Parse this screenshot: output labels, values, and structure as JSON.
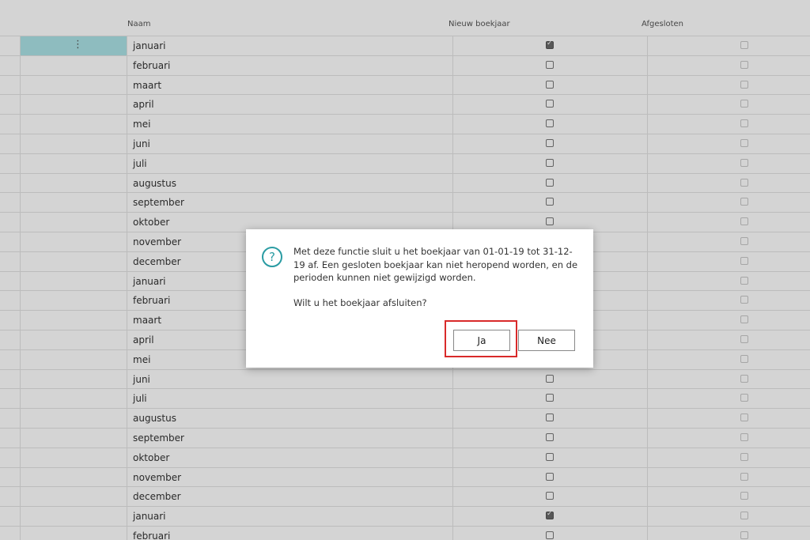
{
  "columns": {
    "naam": "Naam",
    "nieuw_boekjaar": "Nieuw boekjaar",
    "afgesloten": "Afgesloten"
  },
  "rows": [
    {
      "name": "januari",
      "new_year": true
    },
    {
      "name": "februari",
      "new_year": false
    },
    {
      "name": "maart",
      "new_year": false
    },
    {
      "name": "april",
      "new_year": false
    },
    {
      "name": "mei",
      "new_year": false
    },
    {
      "name": "juni",
      "new_year": false
    },
    {
      "name": "juli",
      "new_year": false
    },
    {
      "name": "augustus",
      "new_year": false
    },
    {
      "name": "september",
      "new_year": false
    },
    {
      "name": "oktober",
      "new_year": false
    },
    {
      "name": "november",
      "new_year": false
    },
    {
      "name": "december",
      "new_year": false
    },
    {
      "name": "januari",
      "new_year": true
    },
    {
      "name": "februari",
      "new_year": false
    },
    {
      "name": "maart",
      "new_year": false
    },
    {
      "name": "april",
      "new_year": false
    },
    {
      "name": "mei",
      "new_year": false
    },
    {
      "name": "juni",
      "new_year": false
    },
    {
      "name": "juli",
      "new_year": false
    },
    {
      "name": "augustus",
      "new_year": false
    },
    {
      "name": "september",
      "new_year": false
    },
    {
      "name": "oktober",
      "new_year": false
    },
    {
      "name": "november",
      "new_year": false
    },
    {
      "name": "december",
      "new_year": false
    },
    {
      "name": "januari",
      "new_year": true
    },
    {
      "name": "februari",
      "new_year": false
    }
  ],
  "dialog": {
    "icon": "question-icon",
    "message": "Met deze functie sluit u het boekjaar van 01-01-19 tot 31-12-19 af. Een gesloten boekjaar kan niet heropend worden, en de perioden kunnen niet gewijzigd worden.",
    "question": "Wilt u het boekjaar afsluiten?",
    "yes_label": "Ja",
    "no_label": "Nee",
    "highlight_color": "#d92a2a"
  }
}
